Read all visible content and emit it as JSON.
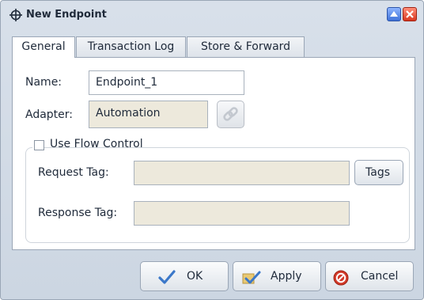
{
  "window": {
    "title": "New Endpoint",
    "icons": {
      "app": "endpoint-icon",
      "maximize": "maximize-icon",
      "close": "close-icon"
    }
  },
  "tabs": [
    {
      "label": "General",
      "active": true
    },
    {
      "label": "Transaction Log",
      "active": false
    },
    {
      "label": "Store & Forward",
      "active": false
    }
  ],
  "general": {
    "name_label": "Name:",
    "name_value": "Endpoint_1",
    "adapter_label": "Adapter:",
    "adapter_value": "Automation",
    "adapter_link_icon": "link-icon",
    "flow_control": {
      "label": "Use Flow Control",
      "checked": false,
      "request_tag_label": "Request Tag:",
      "request_tag_value": "",
      "tags_button": "Tags",
      "response_tag_label": "Response Tag:",
      "response_tag_value": ""
    }
  },
  "buttons": {
    "ok": "OK",
    "apply": "Apply",
    "cancel": "Cancel",
    "icons": {
      "ok": "checkmark-icon",
      "apply": "apply-icon",
      "cancel": "cancel-icon"
    }
  },
  "colors": {
    "readonly_field": "#ede9dc",
    "ok_check": "#3b78c9",
    "cancel_red": "#d23a2a"
  }
}
